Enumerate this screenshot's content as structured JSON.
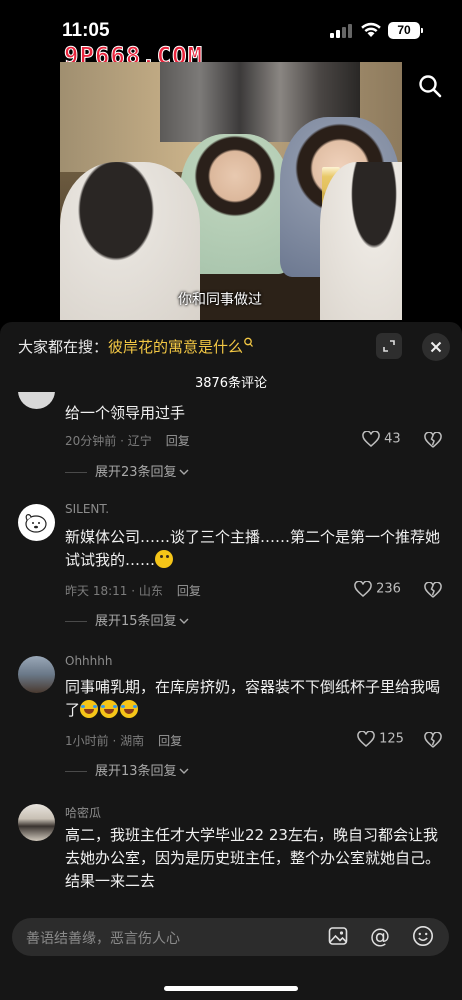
{
  "status_bar": {
    "time": "11:05",
    "battery": "70"
  },
  "watermark": "9P668.COM",
  "video": {
    "caption": "你和同事做过"
  },
  "panel": {
    "search_prefix": "大家都在搜：",
    "search_keyword": "彼岸花的寓意是什么",
    "comment_count": "3876条评论"
  },
  "comments": [
    {
      "text": "给一个领导用过手",
      "time_loc": "20分钟前 · 辽宁",
      "reply_label": "回复",
      "likes": "43",
      "expand": "展开23条回复"
    },
    {
      "username": "SILENT.",
      "text": "新媒体公司……谈了三个主播……第二个是第一个推荐她试试我的……",
      "time_loc": "昨天 18:11 · 山东",
      "reply_label": "回复",
      "likes": "236",
      "expand": "展开15条回复"
    },
    {
      "username": "Ohhhhh",
      "text": "同事哺乳期，在库房挤奶，容器装不下倒纸杯子里给我喝了",
      "time_loc": "1小时前 · 湖南",
      "reply_label": "回复",
      "likes": "125",
      "expand": "展开13条回复"
    },
    {
      "username": "哈密瓜",
      "text": "高二，我班主任才大学毕业22 23左右，晚自习都会让我去她办公室，因为是历史班主任，整个办公室就她自己。结果一来二去"
    }
  ],
  "input": {
    "placeholder": "善语结善缘，恶言伤人心",
    "at_symbol": "@"
  },
  "colors": {
    "accent_keyword": "#f2c744",
    "panel_bg": "#161616",
    "input_bg": "#2c2c2c"
  }
}
